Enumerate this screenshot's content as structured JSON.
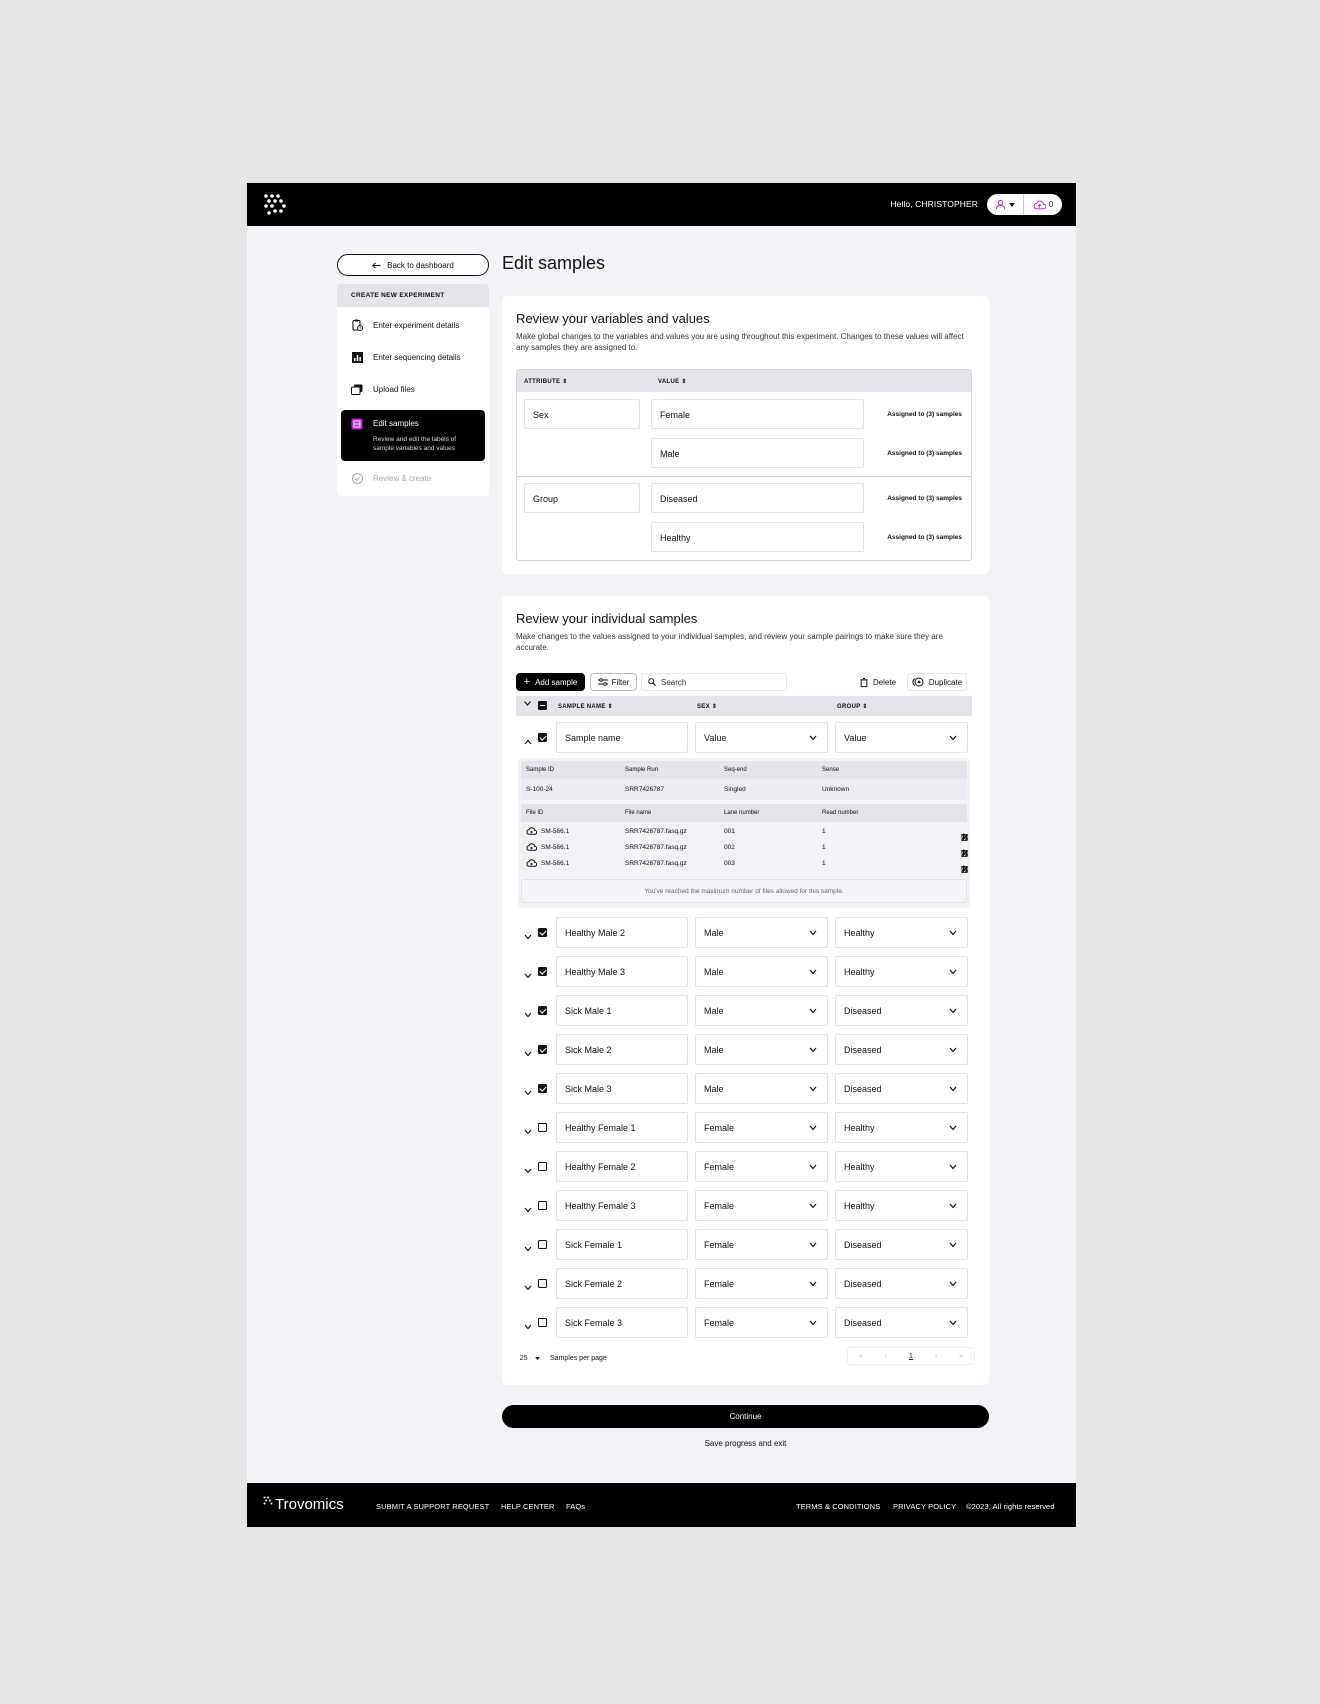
{
  "header": {
    "greeting": "Hello, CHRISTOPHER",
    "upload_count": "0"
  },
  "nav": {
    "back_label": "Back to dashboard",
    "section_title": "CREATE NEW EXPERIMENT",
    "steps": [
      {
        "label": "Enter experiment details",
        "icon": "clipboard-clock-icon"
      },
      {
        "label": "Enter sequencing details",
        "icon": "bar-chart-icon"
      },
      {
        "label": "Upload files",
        "icon": "stacked-files-icon"
      },
      {
        "label": "Edit samples",
        "description": "Review and edit the labels of sample variables and values",
        "icon": "edit-samples-icon"
      },
      {
        "label": "Review & create",
        "icon": "check-circle-icon"
      }
    ]
  },
  "page": {
    "title": "Edit samples"
  },
  "variables": {
    "title": "Review your variables and values",
    "description": "Make global changes to the variables and values you are using throughout this experiment. Changes to these values will affect any samples they are assigned to.",
    "col_attribute": "ATTRIBUTE",
    "col_value": "VALUE",
    "groups": [
      {
        "attribute": "Sex",
        "values": [
          {
            "value": "Female",
            "assigned": "Assigned to (3) samples"
          },
          {
            "value": "Male",
            "assigned": "Assigned to (3) samples"
          }
        ]
      },
      {
        "attribute": "Group",
        "values": [
          {
            "value": "Diseased",
            "assigned": "Assigned to (3) samples"
          },
          {
            "value": "Healthy",
            "assigned": "Assigned to (3) samples"
          }
        ]
      }
    ]
  },
  "samples": {
    "title": "Review your individual samples",
    "description": "Make changes to the values assigned to your individual samples, and review your sample pairings to make sure they are accurate.",
    "toolbar": {
      "add_label": "Add sample",
      "filter_label": "Filter",
      "search_placeholder": "Search",
      "delete_label": "Delete",
      "duplicate_label": "Duplicate"
    },
    "columns": {
      "name": "SAMPLE NAME",
      "sex": "SEX",
      "group": "GROUP"
    },
    "expanded_row": {
      "name": "Sample name",
      "sex": "Value",
      "group": "Value"
    },
    "detail": {
      "meta_headers": [
        "Sample ID",
        "Sample Run",
        "Seq-end",
        "Sense"
      ],
      "meta_values": [
        "S-100-24",
        "SRR7426787",
        "Singled",
        "Unknown"
      ],
      "file_headers": [
        "File ID",
        "File name",
        "Lane number",
        "Read number"
      ],
      "files": [
        {
          "id": "SM-566.1",
          "name": "SRR7426787.fasq.gz",
          "lane": "001",
          "read": "1"
        },
        {
          "id": "SM-566.1",
          "name": "SRR7426787.fasq.gz",
          "lane": "002",
          "read": "1"
        },
        {
          "id": "SM-566.1",
          "name": "SRR7426787.fasq.gz",
          "lane": "003",
          "read": "1"
        }
      ],
      "max_message": "You've reached the maximum number of files allowed for this sample."
    },
    "rows": [
      {
        "name": "Healthy Male 2",
        "sex": "Male",
        "group": "Healthy",
        "checked": true
      },
      {
        "name": "Healthy Male 3",
        "sex": "Male",
        "group": "Healthy",
        "checked": true
      },
      {
        "name": "Sick Male 1",
        "sex": "Male",
        "group": "Diseased",
        "checked": true
      },
      {
        "name": "Sick Male 2",
        "sex": "Male",
        "group": "Diseased",
        "checked": true
      },
      {
        "name": "Sick Male 3",
        "sex": "Male",
        "group": "Diseased",
        "checked": true
      },
      {
        "name": "Healthy Female 1",
        "sex": "Female",
        "group": "Healthy",
        "checked": false
      },
      {
        "name": "Healthy Female 2",
        "sex": "Female",
        "group": "Healthy",
        "checked": false
      },
      {
        "name": "Healthy Female 3",
        "sex": "Female",
        "group": "Healthy",
        "checked": false
      },
      {
        "name": "Sick Female 1",
        "sex": "Female",
        "group": "Diseased",
        "checked": false
      },
      {
        "name": "Sick Female 2",
        "sex": "Female",
        "group": "Diseased",
        "checked": false
      },
      {
        "name": "Sick Female 3",
        "sex": "Female",
        "group": "Diseased",
        "checked": false
      }
    ],
    "pagination": {
      "per_page": "25",
      "per_page_label": "Samples per page",
      "current_page": "1"
    }
  },
  "actions": {
    "continue_label": "Continue",
    "save_label": "Save progress and exit"
  },
  "footer": {
    "brand": "Trovomics",
    "links_left": [
      "SUBMIT A SUPPORT REQUEST",
      "HELP CENTER",
      "FAQs"
    ],
    "links_right": [
      "TERMS & CONDITIONS",
      "PRIVACY POLICY"
    ],
    "copyright": "©2023, All rights reserved"
  },
  "colors": {
    "accent": "#c026d3",
    "dark": "#000000",
    "panel": "#f2f2f7"
  }
}
